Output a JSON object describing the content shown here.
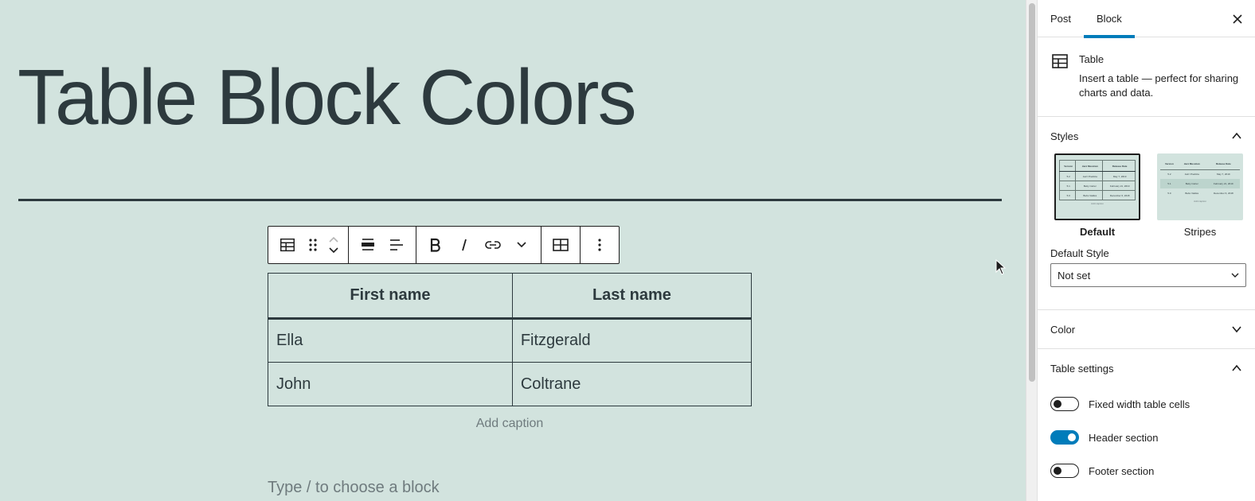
{
  "post": {
    "title": "Table Block Colors",
    "appender_placeholder": "Type / to choose a block"
  },
  "table": {
    "headers": [
      "First name",
      "Last name"
    ],
    "rows": [
      [
        "Ella",
        "Fitzgerald"
      ],
      [
        "John",
        "Coltrane"
      ]
    ],
    "caption_placeholder": "Add caption"
  },
  "toolbar": {
    "buttons": [
      "table-icon",
      "drag-handle-icon",
      "move-up-icon",
      "move-down-icon",
      "align-wide-icon",
      "text-align-left-icon",
      "bold-icon",
      "italic-icon",
      "link-icon",
      "more-formatting-icon",
      "edit-table-icon",
      "options-icon"
    ]
  },
  "sidebar": {
    "tabs": [
      "Post",
      "Block"
    ],
    "active_tab": "Block",
    "block": {
      "name": "Table",
      "description": "Insert a table — perfect for sharing charts and data."
    },
    "styles": {
      "title": "Styles",
      "options": [
        "Default",
        "Stripes"
      ],
      "selected": "Default",
      "mini_headers": [
        "Version",
        "Jazz Musician",
        "Release Date"
      ],
      "mini_rows": [
        [
          "5.2",
          "Jazz Predicta",
          "May 7, 2019"
        ],
        [
          "5.1",
          "Betty Carter",
          "February 21, 2019"
        ],
        [
          "5.0",
          "Bebo Valdés",
          "December 6, 2018"
        ]
      ],
      "mini_caption": "Add caption",
      "default_style_label": "Default Style",
      "default_style_value": "Not set"
    },
    "color_panel": "Color",
    "table_settings": {
      "title": "Table settings",
      "toggles": [
        {
          "label": "Fixed width table cells",
          "on": false
        },
        {
          "label": "Header section",
          "on": true
        },
        {
          "label": "Footer section",
          "on": false
        }
      ]
    }
  },
  "colors": {
    "canvas_bg": "#d2e3de",
    "text": "#2d3a3e",
    "accent": "#007cba"
  }
}
